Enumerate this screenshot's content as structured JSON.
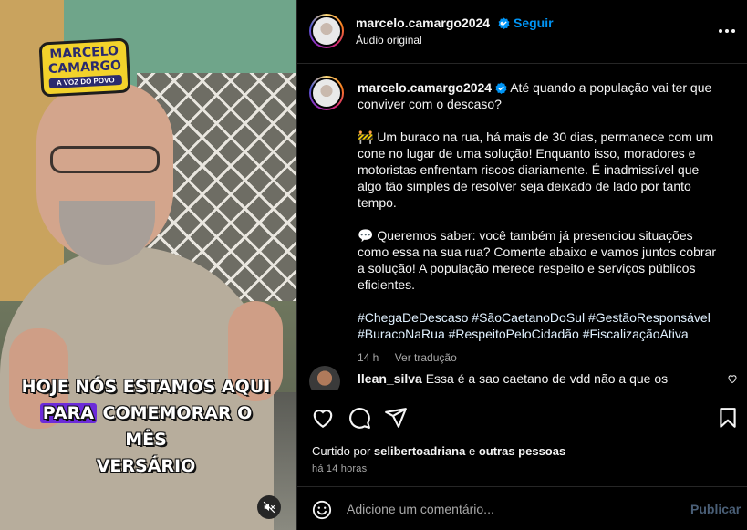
{
  "video": {
    "logo": {
      "line1": "MARCELO",
      "line2": "CAMARGO",
      "line3": "A VOZ DO POVO"
    },
    "caption": {
      "line1": "HOJE NÓS ESTAMOS AQUI",
      "line2_highlight": "PARA",
      "line2_rest": " COMEMORAR O MÊS",
      "line3": "VERSÁRIO"
    },
    "mute_icon": "speaker-muted-icon"
  },
  "header": {
    "username": "marcelo.camargo2024",
    "separator": "•",
    "follow_label": "Seguir",
    "audio_label": "Áudio original",
    "more_icon": "more-options-icon"
  },
  "post": {
    "username": "marcelo.camargo2024",
    "text_intro": "Até quando a população vai ter que conviver com o descaso?",
    "paragraph1": "🚧 Um buraco na rua, há mais de 30 dias, permanece com um cone no lugar de uma solução! Enquanto isso, moradores e motoristas enfrentam riscos diariamente. É inadmissível que algo tão simples de resolver seja deixado de lado por tanto tempo.",
    "paragraph2": "💬 Queremos saber: você também já presenciou situações como essa na sua rua? Comente abaixo e vamos juntos cobrar a solução! A população merece respeito e serviços públicos eficientes.",
    "hashtags": "#ChegaDeDescaso #SãoCaetanoDoSul #GestãoResponsável #BuracoNaRua #RespeitoPeloCidadão #FiscalizaçãoAtiva",
    "time": "14 h",
    "see_translation": "Ver tradução"
  },
  "comments": [
    {
      "username": "llean_silva",
      "text": "Essa é a sao caetano de vdd não a que os políticos falam"
    }
  ],
  "actions": {
    "like_icon": "heart-icon",
    "comment_icon": "comment-icon",
    "share_icon": "share-icon",
    "save_icon": "bookmark-icon",
    "liked_by_prefix": "Curtido por ",
    "liked_by_user": "selibertoadriana",
    "liked_by_middle": " e ",
    "liked_by_others": "outras pessoas",
    "timestamp": "há 14 horas"
  },
  "comment_box": {
    "placeholder": "Adicione um comentário...",
    "publish_label": "Publicar",
    "emoji_icon": "emoji-icon"
  },
  "colors": {
    "accent": "#0095f6",
    "background": "#000000",
    "muted_text": "#a8a8a8",
    "caption_highlight": "#6c2bd9"
  }
}
